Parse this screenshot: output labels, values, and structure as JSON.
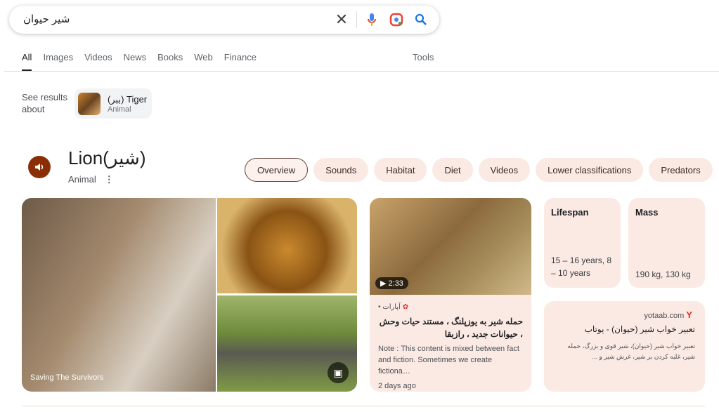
{
  "search": {
    "query": "شیر حیوان"
  },
  "tabs": [
    "All",
    "Images",
    "Videos",
    "News",
    "Books",
    "Web",
    "Finance"
  ],
  "tools": "Tools",
  "see_results": {
    "label": "See results about",
    "chip_title": "(ببر) Tiger",
    "chip_sub": "Animal"
  },
  "entity": {
    "title": "Lion(شیر)",
    "subtitle": "Animal"
  },
  "chips": [
    "Overview",
    "Sounds",
    "Habitat",
    "Diet",
    "Videos",
    "Lower classifications",
    "Predators"
  ],
  "images": {
    "caption": "Saving The Survivors"
  },
  "video": {
    "duration": "2:33",
    "source": "آپارات •",
    "title": "حمله شیر به یوزپلنگ ، مستند حیات وحش ، حیوانات جدید ، رازبقا",
    "desc": "Note : This content is mixed between fact and fiction. Sometimes we create fictiona…",
    "age": "2 days ago"
  },
  "facts": [
    {
      "label": "Lifespan",
      "value": "15 – 16 years, 8 – 10 years"
    },
    {
      "label": "Mass",
      "value": "190 kg, 130 kg"
    }
  ],
  "web": {
    "site": "yotaab.com",
    "favicon": "Y",
    "title": "تعبیر خواب شیر (حیوان) - یوتاب",
    "snippet": "تعبیر خواب شیر (حیوان)، شیر قوی و بزرگ، حمله شیر، غلبه کردن بر شیر، غرش شیر و ..."
  },
  "colors": {
    "accent": "#8a2f05",
    "card": "#fbe9e4",
    "link": "#1a73e8"
  }
}
